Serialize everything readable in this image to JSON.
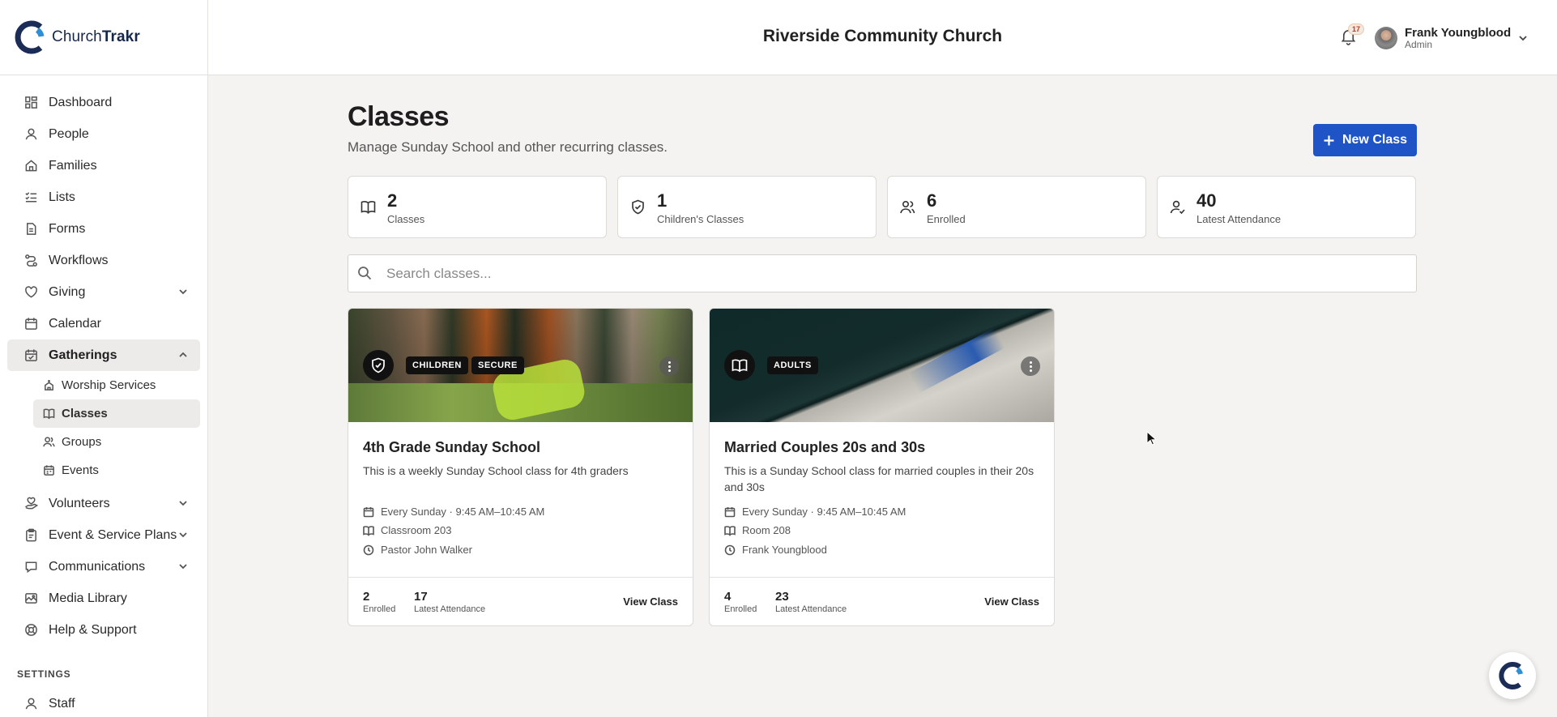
{
  "brand": {
    "name_part1": "Church",
    "name_part2": "Trakr",
    "accent": "#1f54c7"
  },
  "sidebar": {
    "items": [
      {
        "label": "Dashboard",
        "icon": "grid-icon"
      },
      {
        "label": "People",
        "icon": "person-icon"
      },
      {
        "label": "Families",
        "icon": "home-icon"
      },
      {
        "label": "Lists",
        "icon": "list-check-icon"
      },
      {
        "label": "Forms",
        "icon": "document-icon"
      },
      {
        "label": "Workflows",
        "icon": "workflow-icon"
      },
      {
        "label": "Giving",
        "icon": "heart-icon"
      },
      {
        "label": "Calendar",
        "icon": "calendar-icon"
      },
      {
        "label": "Gatherings",
        "icon": "calendar-check-icon"
      }
    ],
    "gatherings_sub": [
      {
        "label": "Worship Services",
        "icon": "church-icon"
      },
      {
        "label": "Classes",
        "icon": "book-icon"
      },
      {
        "label": "Groups",
        "icon": "group-icon"
      },
      {
        "label": "Events",
        "icon": "calendar-icon"
      }
    ],
    "items2": [
      {
        "label": "Volunteers",
        "icon": "heart-hand-icon"
      },
      {
        "label": "Event & Service Plans",
        "icon": "clipboard-icon"
      },
      {
        "label": "Communications",
        "icon": "chat-icon"
      },
      {
        "label": "Media Library",
        "icon": "media-icon"
      },
      {
        "label": "Help & Support",
        "icon": "help-icon"
      }
    ],
    "settings_label": "SETTINGS",
    "settings_items": [
      {
        "label": "Staff",
        "icon": "staff-icon"
      }
    ]
  },
  "header": {
    "church_name": "Riverside Community Church",
    "notification_count": "17",
    "user_name": "Frank Youngblood",
    "user_role": "Admin"
  },
  "page": {
    "title": "Classes",
    "subtitle": "Manage Sunday School and other recurring classes.",
    "new_button": "New Class"
  },
  "stats": [
    {
      "value": "2",
      "label": "Classes",
      "icon": "book-icon"
    },
    {
      "value": "1",
      "label": "Children's Classes",
      "icon": "shield-check-icon"
    },
    {
      "value": "6",
      "label": "Enrolled",
      "icon": "users-icon"
    },
    {
      "value": "40",
      "label": "Latest Attendance",
      "icon": "user-check-icon"
    }
  ],
  "search": {
    "placeholder": "Search classes..."
  },
  "classes": [
    {
      "tags": [
        "CHILDREN",
        "SECURE"
      ],
      "badge_icon": "shield-check-icon",
      "title": "4th Grade Sunday School",
      "description": "This is a weekly Sunday School class for 4th graders",
      "schedule": "Every Sunday · 9:45 AM–10:45 AM",
      "room": "Classroom 203",
      "leader": "Pastor John Walker",
      "enrolled": "2",
      "enrolled_label": "Enrolled",
      "attendance": "17",
      "attendance_label": "Latest Attendance",
      "view_label": "View Class"
    },
    {
      "tags": [
        "ADULTS"
      ],
      "badge_icon": "book-icon",
      "title": "Married Couples 20s and 30s",
      "description": "This is a Sunday School class for married couples in their 20s and 30s",
      "schedule": "Every Sunday · 9:45 AM–10:45 AM",
      "room": "Room 208",
      "leader": "Frank Youngblood",
      "enrolled": "4",
      "enrolled_label": "Enrolled",
      "attendance": "23",
      "attendance_label": "Latest Attendance",
      "view_label": "View Class"
    }
  ]
}
